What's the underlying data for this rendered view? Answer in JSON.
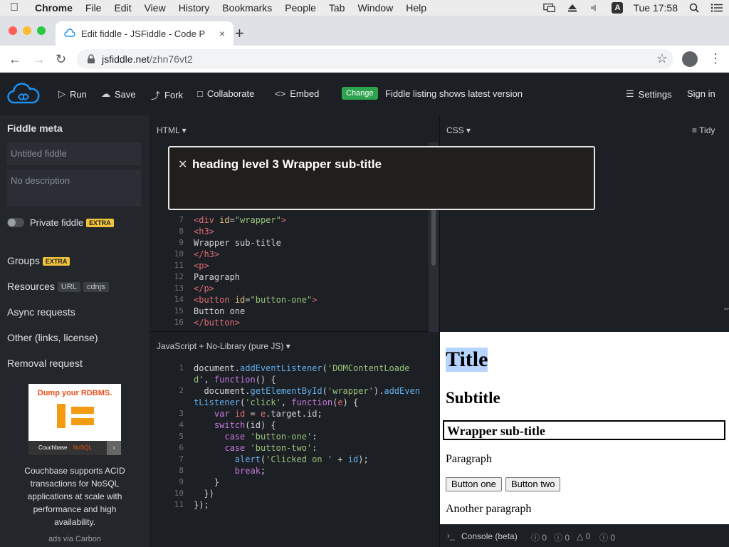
{
  "menubar": {
    "app": "Chrome",
    "items": [
      "File",
      "Edit",
      "View",
      "History",
      "Bookmarks",
      "People",
      "Tab",
      "Window",
      "Help"
    ],
    "clock": "Tue 17:58",
    "input_source": "A"
  },
  "browser": {
    "tab_title": "Edit fiddle - JSFiddle - Code Playground",
    "tab_close": "×",
    "new_tab": "+",
    "url_host": "jsfiddle.net",
    "url_path": "/zhn76vt2"
  },
  "header": {
    "run": "Run",
    "save": "Save",
    "fork": "Fork",
    "collaborate": "Collaborate",
    "embed": "Embed",
    "change_badge": "Change",
    "listing_text": "Fiddle listing shows latest version",
    "settings": "Settings",
    "sign_in": "Sign in"
  },
  "sidebar": {
    "title": "Fiddle meta",
    "name_placeholder": "Untitled fiddle",
    "desc_placeholder": "No description",
    "private_label": "Private fiddle",
    "extra_badge": "EXTRA",
    "groups": "Groups",
    "resources": "Resources",
    "url_pill": "URL",
    "cdnjs_pill": "cdnjs",
    "async": "Async requests",
    "other": "Other (links, license)",
    "removal": "Removal request",
    "ad_headline": "Dump your RDBMS.",
    "ad_brand": "Couchbase",
    "ad_tag": "NoSQL",
    "ad_text": "Couchbase supports ACID transactions for NoSQL applications at scale with performance and high availability.",
    "ad_via": "ads via Carbon"
  },
  "html_panel": {
    "label": "HTML",
    "lines": [
      {
        "n": "7",
        "html": "<span class='tag'>&lt;div</span> <span class='attr'>id</span>=<span class='str'>\"wrapper\"</span><span class='tag'>&gt;</span>"
      },
      {
        "n": "8",
        "html": "<span class='tag'>&lt;h3&gt;</span>"
      },
      {
        "n": "9",
        "html": "Wrapper sub-title"
      },
      {
        "n": "10",
        "html": "<span class='tag'>&lt;/h3&gt;</span>"
      },
      {
        "n": "11",
        "html": "<span class='tag'>&lt;p&gt;</span>"
      },
      {
        "n": "12",
        "html": "Paragraph"
      },
      {
        "n": "13",
        "html": "<span class='tag'>&lt;/p&gt;</span>"
      },
      {
        "n": "14",
        "html": "<span class='tag'>&lt;button</span> <span class='attr'>id</span>=<span class='str'>\"button-one\"</span><span class='tag'>&gt;</span>"
      },
      {
        "n": "15",
        "html": "Button one"
      },
      {
        "n": "16",
        "html": "<span class='tag'>&lt;/button&gt;</span>"
      }
    ]
  },
  "css_panel": {
    "label": "CSS",
    "tidy": "Tidy"
  },
  "js_panel": {
    "label": "JavaScript + No-Library (pure JS)",
    "lines": [
      {
        "n": "1",
        "html": "document.<span class='fn'>addEventListener</span>(<span class='str'>'DOMContentLoade</span>"
      },
      {
        "n": "",
        "html": "<span class='str'>d'</span>, <span class='kw'>function</span>() {"
      },
      {
        "n": "2",
        "html": "  document.<span class='fn'>getElementById</span>(<span class='str'>'wrapper'</span>).<span class='fn'>addEven</span>"
      },
      {
        "n": "",
        "html": "<span class='fn'>tListener</span>(<span class='str'>'click'</span>, <span class='kw'>function</span>(<span class='tag'>e</span>) {"
      },
      {
        "n": "3",
        "html": "    <span class='kw'>var</span> <span class='tag'>id</span> = <span class='tag'>e</span>.target.id;"
      },
      {
        "n": "4",
        "html": "    <span class='kw'>switch</span>(id) {"
      },
      {
        "n": "5",
        "html": "      <span class='kw'>case</span> <span class='str'>'button-one'</span>:"
      },
      {
        "n": "6",
        "html": "      <span class='kw'>case</span> <span class='str'>'button-two'</span>:"
      },
      {
        "n": "7",
        "html": "        <span class='fn'>alert</span>(<span class='str'>'Clicked on '</span> + <span class='fn'>id</span>);"
      },
      {
        "n": "8",
        "html": "        <span class='kw'>break</span>;"
      },
      {
        "n": "9",
        "html": "    }"
      },
      {
        "n": "10",
        "html": "  })"
      },
      {
        "n": "11",
        "html": "});"
      }
    ]
  },
  "tooltip": {
    "text": "heading level 3 Wrapper sub-title"
  },
  "result": {
    "title": "Title",
    "subtitle": "Subtitle",
    "wrapper_subtitle": "Wrapper sub-title",
    "paragraph": "Paragraph",
    "button_one": "Button one",
    "button_two": "Button two",
    "paragraph2": "Another paragraph"
  },
  "console": {
    "label": "Console (beta)",
    "counts": [
      "0",
      "0",
      "0",
      "0"
    ]
  },
  "colors": {
    "accent_green": "#2ea44f",
    "extra_yellow": "#f0c33c",
    "logo_blue": "#1c90f3",
    "highlight": "#b6d4fe"
  }
}
